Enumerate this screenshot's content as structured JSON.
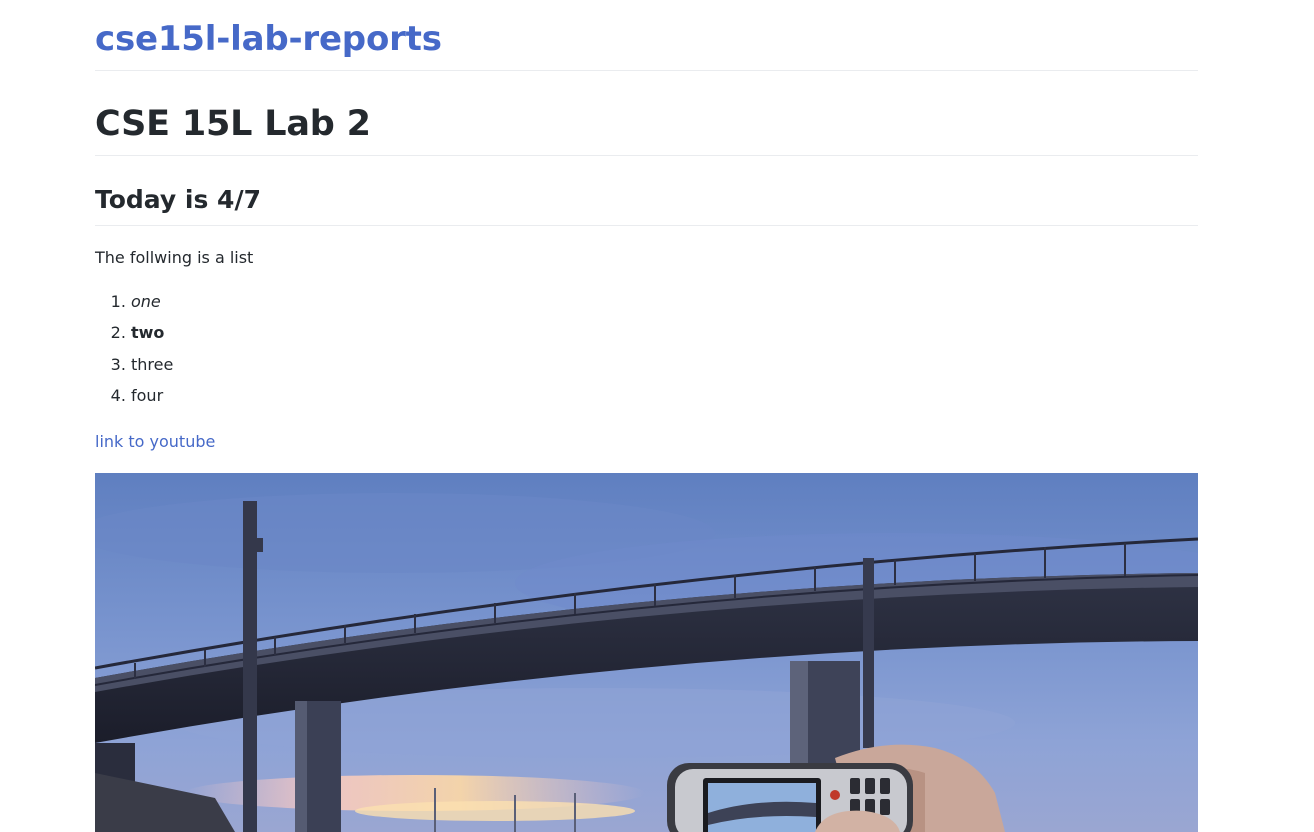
{
  "header": {
    "site_title": "cse15l-lab-reports"
  },
  "main": {
    "page_title": "CSE 15L Lab 2",
    "subheading": "Today is 4/7",
    "intro": "The follwing is a list",
    "list": [
      {
        "label": "one",
        "style": "italic"
      },
      {
        "label": "two",
        "style": "bold"
      },
      {
        "label": "three",
        "style": "normal"
      },
      {
        "label": "four",
        "style": "normal"
      }
    ],
    "link_label": "link to youtube"
  },
  "colors": {
    "link": "#4669c8",
    "text": "#24292e",
    "rule": "#eaecef"
  }
}
